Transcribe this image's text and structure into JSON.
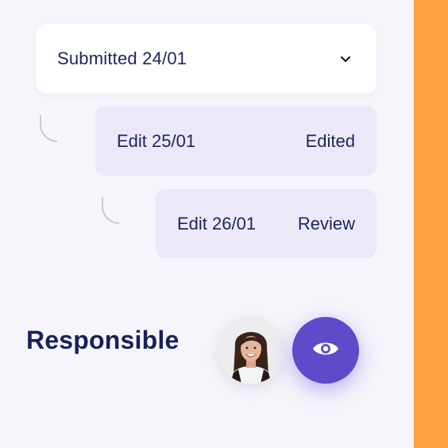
{
  "dropdown": {
    "label": "Submitted 24/01",
    "icon": "chevron-down-icon"
  },
  "history": [
    {
      "label": "Edit 25/01",
      "status": "Edited"
    },
    {
      "label": "Edit 26/01",
      "status": "Review"
    }
  ],
  "responsible": {
    "label": "Responsible",
    "avatar": "user-avatar",
    "action_icon": "eye-icon"
  },
  "colors": {
    "accent": "#5e4bc9",
    "side_strip": "#ffa141",
    "card_bg": "#ebe9f8",
    "text": "#1d2560"
  }
}
